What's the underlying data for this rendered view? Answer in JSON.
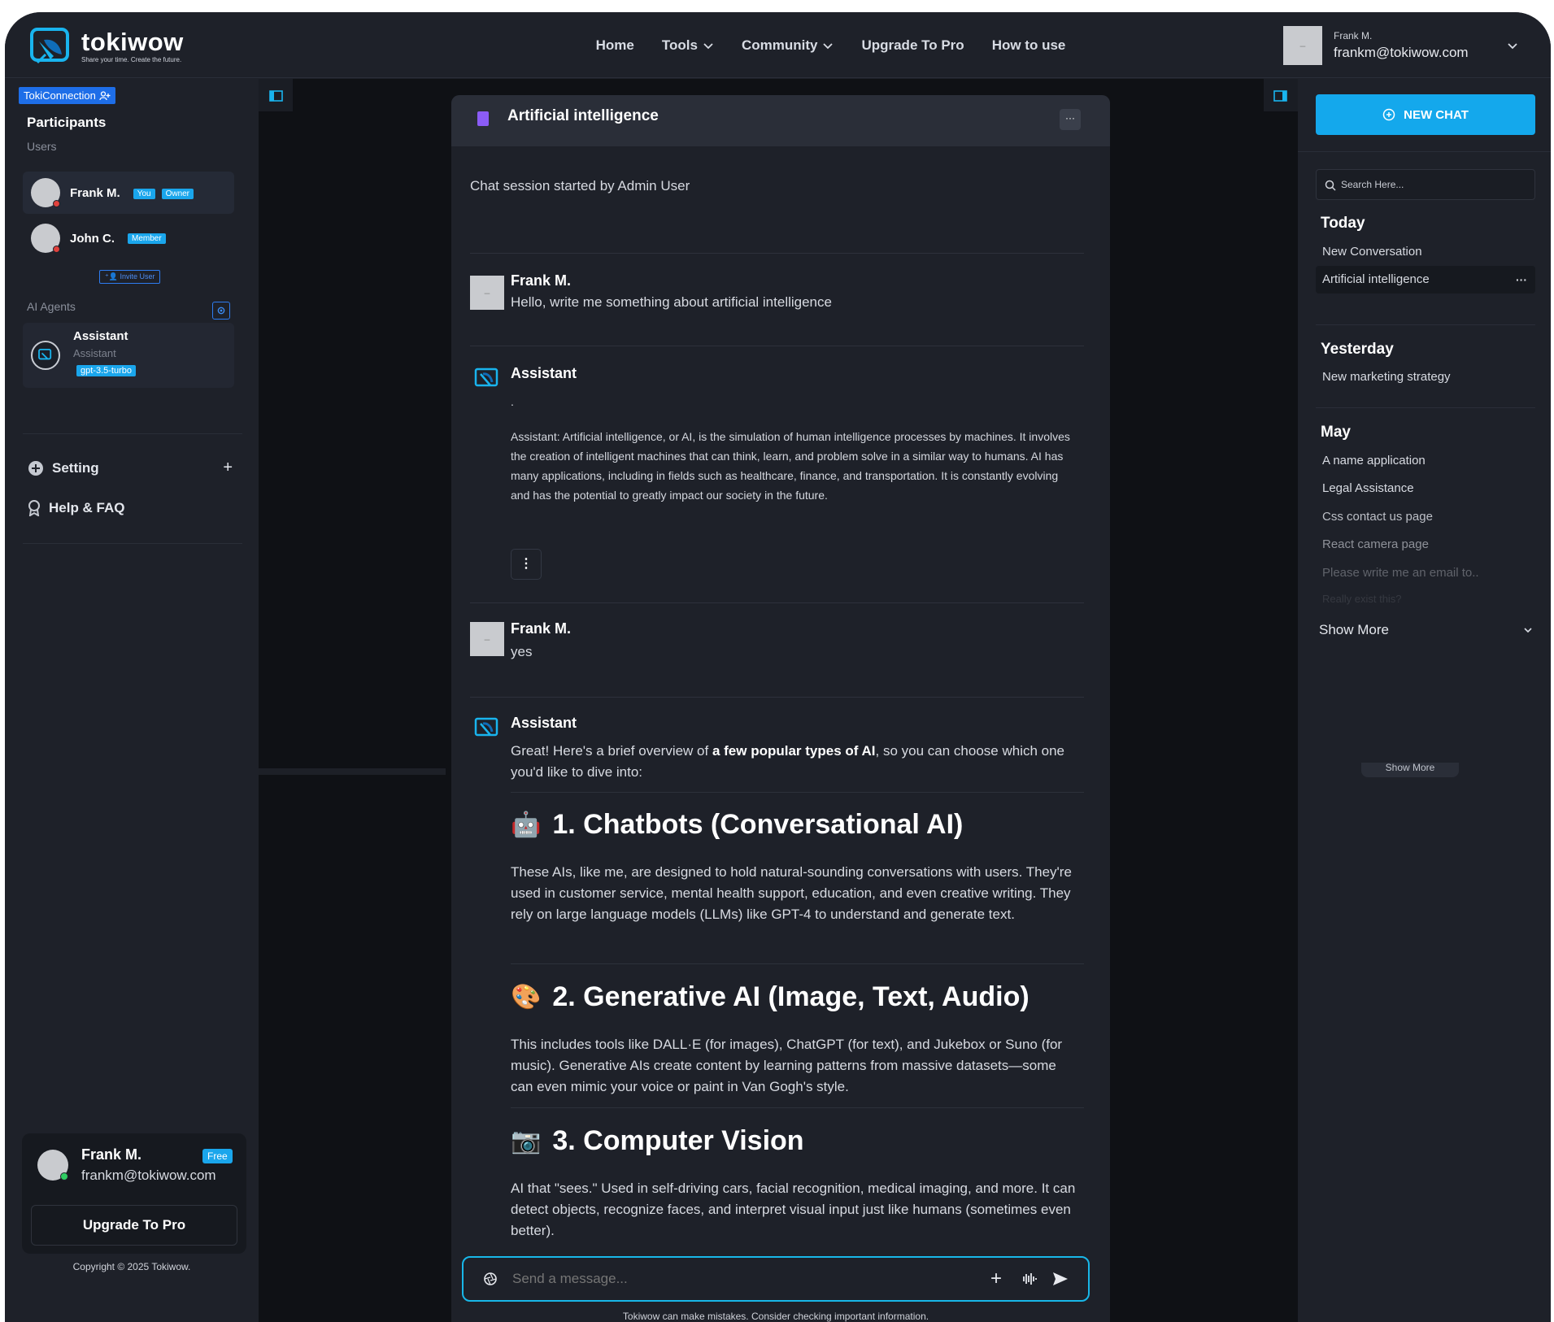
{
  "header": {
    "brand": "tokiwow",
    "tagline": "Share your time. Create the future.",
    "nav": [
      {
        "label": "Home"
      },
      {
        "label": "Tools",
        "has_dropdown": true
      },
      {
        "label": "Community",
        "has_dropdown": true
      },
      {
        "label": "Upgrade To Pro"
      },
      {
        "label": "How to use"
      }
    ],
    "account": {
      "name": "Frank M.",
      "email": "frankm@tokiwow.com"
    }
  },
  "left_sidebar": {
    "connection_badge": "TokiConnection",
    "participants_title": "Participants",
    "users_label": "Users",
    "users": [
      {
        "name": "Frank M.",
        "badges": [
          "You",
          "Owner"
        ]
      },
      {
        "name": "John C.",
        "badges": [
          "Member"
        ]
      }
    ],
    "invite_label": "Invite User",
    "agents_label": "AI Agents",
    "agent": {
      "name": "Assistant",
      "role": "Assistant",
      "model": "gpt-3.5-turbo"
    },
    "menu": [
      {
        "label": "Setting",
        "icon": "plus-circle-icon"
      },
      {
        "label": "Help & FAQ",
        "icon": "award-icon"
      }
    ],
    "user_card": {
      "name": "Frank M.",
      "email": "frankm@tokiwow.com",
      "plan": "Free",
      "upgrade_label": "Upgrade To Pro"
    },
    "copyright": "Copyright © 2025 Tokiwow."
  },
  "chat": {
    "title": "Artificial intelligence",
    "more_label": "···",
    "system_note": "Chat session started by Admin User",
    "messages": [
      {
        "author": "Frank M.",
        "text": "Hello, write me something about artificial intelligence"
      },
      {
        "author": "Assistant",
        "dot": ".",
        "text": "Assistant: Artificial intelligence, or AI, is the simulation of human intelligence processes by machines. It involves the creation of intelligent machines that can think, learn, and problem solve in a similar way to humans. AI has many applications, including in fields such as healthcare, finance, and transportation. It is constantly evolving and has the potential to greatly impact our society in the future."
      },
      {
        "author": "Frank M.",
        "text": "yes"
      },
      {
        "author": "Assistant",
        "intro_before": "Great! Here's a brief overview of ",
        "intro_bold": "a few popular types of AI",
        "intro_after": ", so you can choose which one you'd like to dive into:",
        "sections": [
          {
            "emoji": "🤖",
            "heading": "1. Chatbots (Conversational AI)",
            "body": "These AIs, like me, are designed to hold natural-sounding conversations with users. They're used in customer service, mental health support, education, and even creative writing. They rely on large language models (LLMs) like GPT-4 to understand and generate text."
          },
          {
            "emoji": "🎨",
            "heading": "2. Generative AI (Image, Text, Audio)",
            "body": "This includes tools like DALL·E (for images), ChatGPT (for text), and Jukebox or Suno (for music). Generative AIs create content by learning patterns from massive datasets—some can even mimic your voice or paint in Van Gogh's style."
          },
          {
            "emoji": "📷",
            "heading": "3. Computer Vision",
            "body": "AI that \"sees.\" Used in self-driving cars, facial recognition, medical imaging, and more. It can detect objects, recognize faces, and interpret visual input just like humans (sometimes even better)."
          }
        ]
      }
    ],
    "composer_placeholder": "Send a message...",
    "disclaimer": "Tokiwow can make mistakes. Consider checking important information."
  },
  "right_sidebar": {
    "new_chat_label": "NEW CHAT",
    "search_placeholder": "Search Here...",
    "groups": [
      {
        "label": "Today",
        "items": [
          "New Conversation",
          "Artificial intelligence"
        ]
      },
      {
        "label": "Yesterday",
        "items": [
          "New marketing strategy"
        ]
      },
      {
        "label": "May",
        "items": [
          "A name application",
          "Legal Assistance",
          "Css contact us page",
          "React camera page",
          "Please write me an email to..",
          "Really exist this?"
        ]
      }
    ],
    "active_item_more": "···",
    "show_more_label": "Show More",
    "ghost_show_more": "Show More"
  },
  "colors": {
    "accent": "#14a8ec",
    "badge_blue": "#1e6ee8",
    "bg": "#1e2129",
    "main_bg": "#0f1115",
    "composer_border": "#18b7e8"
  }
}
